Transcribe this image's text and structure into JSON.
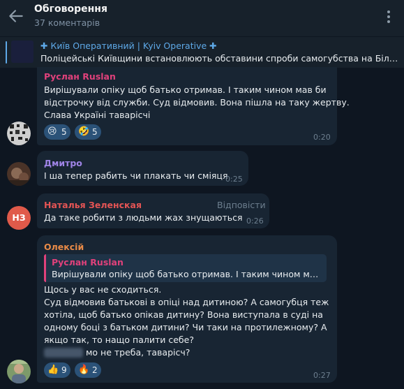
{
  "header": {
    "title": "Обговорення",
    "subtitle": "37 коментарів"
  },
  "pinned": {
    "title": "✚ Київ Оперативний | Kyiv Operative ✚",
    "text": "Поліцейські Київщини встановлюють обставини спроби самогубства на Білоцерківщині"
  },
  "messages": {
    "m1": {
      "author": "Руслан Ruslan",
      "lines": [
        "Вирішували опіку щоб батько отримав. І таким чином мав би",
        "відстрочку від служби. Суд відмовив. Вона пішла на таку жертву.",
        "Слава Україні таварісчі"
      ],
      "reactions": [
        {
          "emoji": "😢",
          "count": "5"
        },
        {
          "emoji": "🤣",
          "count": "5"
        }
      ],
      "time": "0:20"
    },
    "m2": {
      "author": "Дмитро",
      "text": "І ша тепер рабить чи плакать чи сміяця",
      "time": "0:25"
    },
    "m3": {
      "author": "Наталья Зеленская",
      "initials": "НЗ",
      "reply_label": "Відповісти",
      "text": "Да таке робити з людьми  жах   знущаються",
      "time": "0:26"
    },
    "m4": {
      "author": "Олексій",
      "quote_author": "Руслан Ruslan",
      "quote_text": "Вирішували опіку щоб батько отримав. І таким чином мав би відстрочку від служби.",
      "lines": [
        "Щось у вас не сходиться.",
        "Суд відмовив батькові в опіці над дитиною? А самогубця теж",
        "хотіла, щоб батько опікав дитину? Вона виступала в суді на",
        "одному боці з батьком дитини? Чи таки на протилежному? А",
        "якщо так, то нащо палити себе?"
      ],
      "last_line": "мо не треба, таварісч?",
      "reactions": [
        {
          "emoji": "👍",
          "count": "9"
        },
        {
          "emoji": "🔥",
          "count": "2"
        }
      ],
      "time": "0:27"
    }
  },
  "colors": {
    "background": "#0e1621",
    "header": "#17212b",
    "bubble": "#182533",
    "accent": "#5ea9e8",
    "name_ruslan": "#e0417b",
    "name_dmytro": "#9f84e6",
    "name_natalia": "#e45454",
    "name_oleksii": "#e88a47",
    "avatar_natalia": "#e05a4a"
  },
  "icons": {
    "back": "arrow-left-icon",
    "more": "more-vertical-icon"
  }
}
